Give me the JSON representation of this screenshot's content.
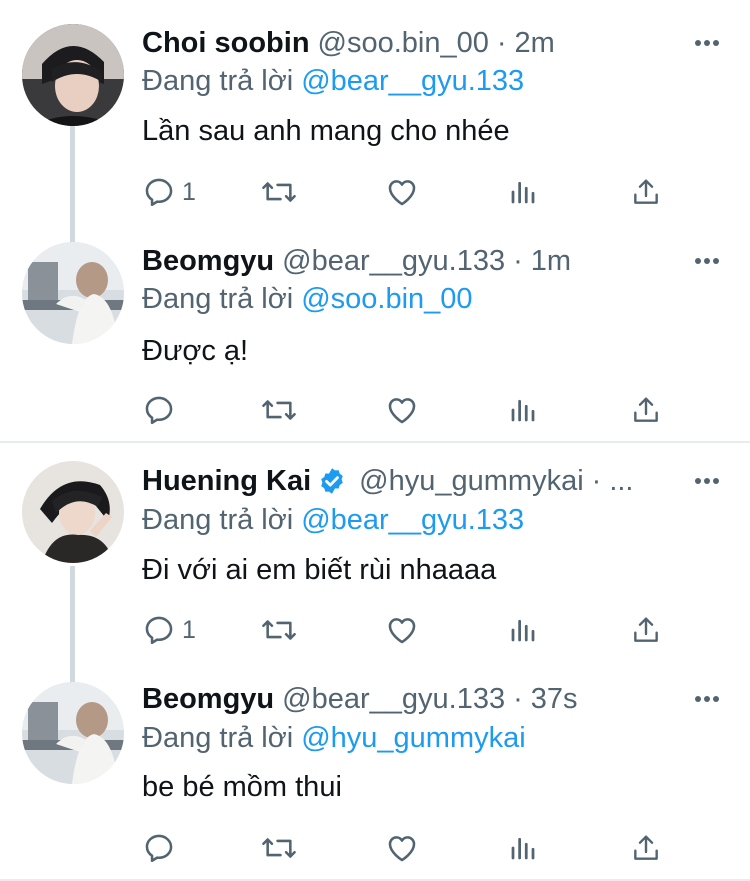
{
  "tweets": [
    {
      "name": "Choi soobin",
      "handle": "@soo.bin_00",
      "separator": "·",
      "time": "2m",
      "replying_prefix": "Đang trả lời",
      "replying_to": "@bear__gyu.133",
      "text": "Lần sau anh mang cho nhée",
      "reply_count": "1",
      "verified": false
    },
    {
      "name": "Beomgyu",
      "handle": "@bear__gyu.133",
      "separator": "·",
      "time": "1m",
      "replying_prefix": "Đang trả lời",
      "replying_to": "@soo.bin_00",
      "text": "Được ạ!",
      "reply_count": "",
      "verified": false
    },
    {
      "name": "Huening Kai",
      "handle": "@hyu_gummykai",
      "separator": "·",
      "time": "...",
      "replying_prefix": "Đang trả lời",
      "replying_to": "@bear__gyu.133",
      "text": "Đi với ai em biết rùi nhaaaa",
      "reply_count": "1",
      "verified": true
    },
    {
      "name": "Beomgyu",
      "handle": "@bear__gyu.133",
      "separator": "·",
      "time": "37s",
      "replying_prefix": "Đang trả lời",
      "replying_to": "@hyu_gummykai",
      "text": "be bé mồm thui",
      "reply_count": "",
      "verified": false
    }
  ],
  "colors": {
    "accent": "#1d9bf0",
    "secondary_text": "#536471",
    "icon": "#536471",
    "thread_line": "#cfd9de",
    "divider": "#e6ecf0"
  },
  "icons": [
    "reply-icon",
    "retweet-icon",
    "like-icon",
    "analytics-icon",
    "share-icon",
    "more-icon",
    "verified-badge-icon"
  ]
}
